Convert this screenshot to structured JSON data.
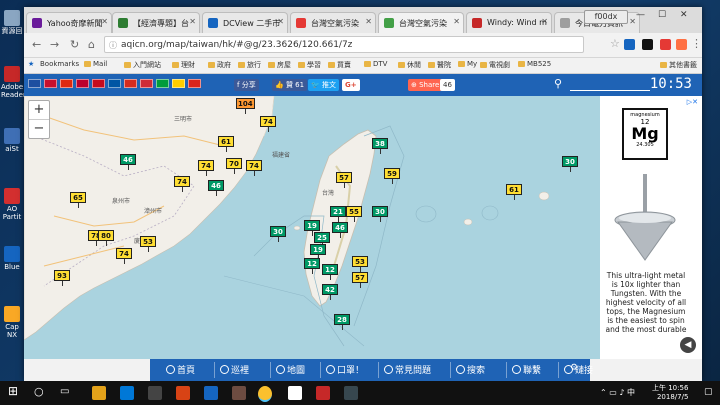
{
  "desktop": {
    "icons": [
      {
        "label": "資源回",
        "color": "#8aa6c2"
      },
      {
        "label": "Adobe Reader",
        "color": "#c62828"
      },
      {
        "label": "aiSt",
        "color": "#3f6fb5"
      },
      {
        "label": "AO Partit",
        "color": "#d32f2f"
      },
      {
        "label": "Blue",
        "color": "#1565c0"
      },
      {
        "label": "Cap NX",
        "color": "#f9a825"
      }
    ]
  },
  "browser": {
    "tabs": [
      {
        "label": "Yahoo奇摩新聞",
        "favicon": "#6a1b9a"
      },
      {
        "label": "【經濟專題】台",
        "favicon": "#2e7d32"
      },
      {
        "label": "DCView 二手市",
        "favicon": "#1565c0"
      },
      {
        "label": "台灣空氣污染",
        "favicon": "#e53935"
      },
      {
        "label": "台灣空氣污染",
        "favicon": "#43a047"
      },
      {
        "label": "Windy: Wind m",
        "favicon": "#c62828"
      },
      {
        "label": "今日電力資訊",
        "favicon": "#9e9e9e"
      }
    ],
    "profile": "f00dx",
    "url": "aqicn.org/map/taiwan/hk/#@g/23.3626/120.661/7z",
    "bookmarks_label": "Bookmarks",
    "bookmarks": [
      "Mail",
      "入門網站",
      "理財",
      "政府",
      "旅行",
      "房屋",
      "學習",
      "買賣",
      "DTV",
      "休閒",
      "醫院",
      "My",
      "電視劇",
      "MB525"
    ],
    "other_bookmarks": "其他書籤"
  },
  "site": {
    "share": {
      "facebook": "分享",
      "like": "贊 61",
      "tweet": "推文",
      "gplus": "G+",
      "share": "Share",
      "share_count": "46"
    },
    "clock": "10:53",
    "flags": [
      "#1e4fa0",
      "#c8102e",
      "#de2910",
      "#bc002d",
      "#c60b1e",
      "#0055a4",
      "#d52b1e",
      "#ce2b37",
      "#009c3b",
      "#ffce00",
      "#da251d"
    ],
    "map_labels": [
      {
        "text": "福建省"
      },
      {
        "text": "台灣"
      },
      {
        "text": "三明市"
      },
      {
        "text": "泉州市"
      },
      {
        "text": "漳州市"
      },
      {
        "text": "廈門市"
      }
    ],
    "markers": [
      {
        "value": "104",
        "level": "usg"
      },
      {
        "value": "74",
        "level": "mod"
      },
      {
        "value": "61",
        "level": "mod"
      },
      {
        "value": "46",
        "level": "good"
      },
      {
        "value": "74",
        "level": "mod"
      },
      {
        "value": "70",
        "level": "mod"
      },
      {
        "value": "74",
        "level": "mod"
      },
      {
        "value": "74",
        "level": "mod"
      },
      {
        "value": "46",
        "level": "good"
      },
      {
        "value": "65",
        "level": "mod"
      },
      {
        "value": "78",
        "level": "mod"
      },
      {
        "value": "80",
        "level": "mod"
      },
      {
        "value": "53",
        "level": "mod"
      },
      {
        "value": "74",
        "level": "mod"
      },
      {
        "value": "93",
        "level": "mod"
      },
      {
        "value": "38",
        "level": "good"
      },
      {
        "value": "59",
        "level": "mod"
      },
      {
        "value": "57",
        "level": "mod"
      },
      {
        "value": "55",
        "level": "mod"
      },
      {
        "value": "21",
        "level": "good"
      },
      {
        "value": "30",
        "level": "good"
      },
      {
        "value": "19",
        "level": "good"
      },
      {
        "value": "46",
        "level": "good"
      },
      {
        "value": "30",
        "level": "good"
      },
      {
        "value": "25",
        "level": "good"
      },
      {
        "value": "19",
        "level": "good"
      },
      {
        "value": "12",
        "level": "good"
      },
      {
        "value": "12",
        "level": "good"
      },
      {
        "value": "53",
        "level": "mod"
      },
      {
        "value": "57",
        "level": "mod"
      },
      {
        "value": "42",
        "level": "good"
      },
      {
        "value": "28",
        "level": "good"
      },
      {
        "value": "61",
        "level": "mod"
      },
      {
        "value": "30",
        "level": "good"
      }
    ],
    "ad": {
      "element_name": "magnesium",
      "element_number": "12",
      "element_symbol": "Mg",
      "element_mass": "24.305",
      "text": "This ultra-light metal is 10x lighter than Tungsten. With the highest velocity of all tops, the Magnesium is the easiest to spin and the most durable"
    },
    "nav": [
      {
        "label": "首頁",
        "icon": "home-icon"
      },
      {
        "label": "巡裡",
        "icon": "location-icon"
      },
      {
        "label": "地圖",
        "icon": "map-icon"
      },
      {
        "label": "口罩！",
        "icon": "mask-icon"
      },
      {
        "label": "常見問題",
        "icon": "faq-icon"
      },
      {
        "label": "搜索",
        "icon": "search-icon"
      },
      {
        "label": "聯繫",
        "icon": "contact-icon"
      },
      {
        "label": "鏈接",
        "icon": "link-icon"
      }
    ]
  },
  "taskbar": {
    "time": "上午 10:56",
    "date": "2018/7/5"
  }
}
